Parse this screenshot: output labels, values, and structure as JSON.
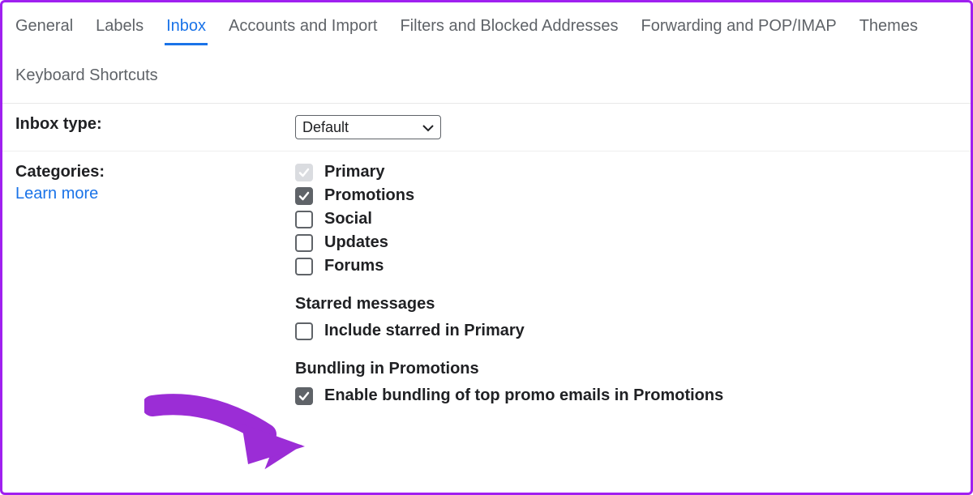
{
  "tabs": {
    "general": "General",
    "labels": "Labels",
    "inbox": "Inbox",
    "accounts": "Accounts and Import",
    "filters": "Filters and Blocked Addresses",
    "forwarding": "Forwarding and POP/IMAP",
    "themes": "Themes",
    "keyboard": "Keyboard Shortcuts"
  },
  "inbox_type": {
    "label": "Inbox type:",
    "value": "Default"
  },
  "categories": {
    "label": "Categories:",
    "learn_more": "Learn more",
    "items": {
      "primary": "Primary",
      "promotions": "Promotions",
      "social": "Social",
      "updates": "Updates",
      "forums": "Forums"
    },
    "starred": {
      "title": "Starred messages",
      "include": "Include starred in Primary"
    },
    "bundling": {
      "title": "Bundling in Promotions",
      "enable": "Enable bundling of top promo emails in Promotions"
    }
  }
}
